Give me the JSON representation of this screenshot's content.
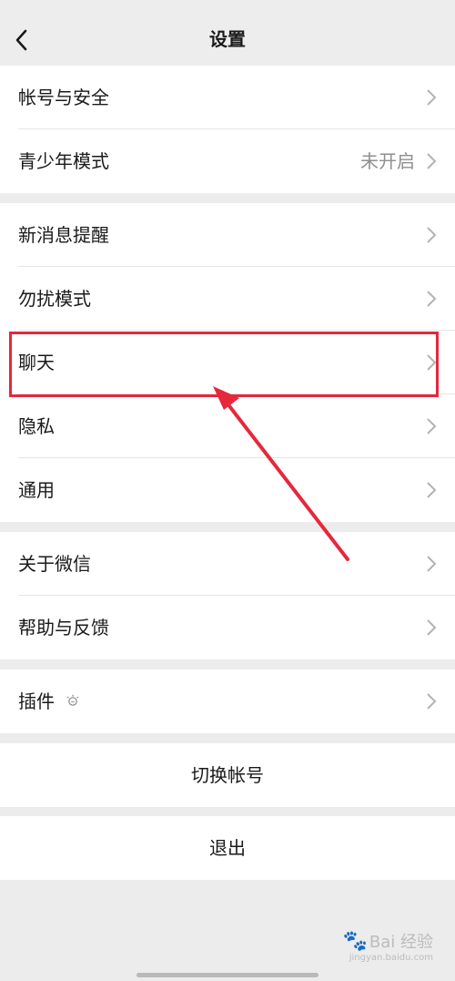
{
  "header": {
    "title": "设置",
    "back_icon": "back-icon"
  },
  "groups": [
    {
      "rows": [
        {
          "label": "帐号与安全",
          "value": ""
        },
        {
          "label": "青少年模式",
          "value": "未开启"
        }
      ]
    },
    {
      "rows": [
        {
          "label": "新消息提醒"
        },
        {
          "label": "勿扰模式"
        },
        {
          "label": "聊天"
        },
        {
          "label": "隐私"
        },
        {
          "label": "通用"
        }
      ]
    },
    {
      "rows": [
        {
          "label": "关于微信"
        },
        {
          "label": "帮助与反馈"
        }
      ]
    },
    {
      "rows": [
        {
          "label": "插件",
          "icon": "plugin-bulb-icon"
        }
      ]
    }
  ],
  "actions": {
    "switch_account": "切换帐号",
    "logout": "退出"
  },
  "annotation": {
    "highlight_color": "#e5283c"
  },
  "watermark": {
    "text": "Bai 经验",
    "sub": "jingyan.baidu.com"
  }
}
